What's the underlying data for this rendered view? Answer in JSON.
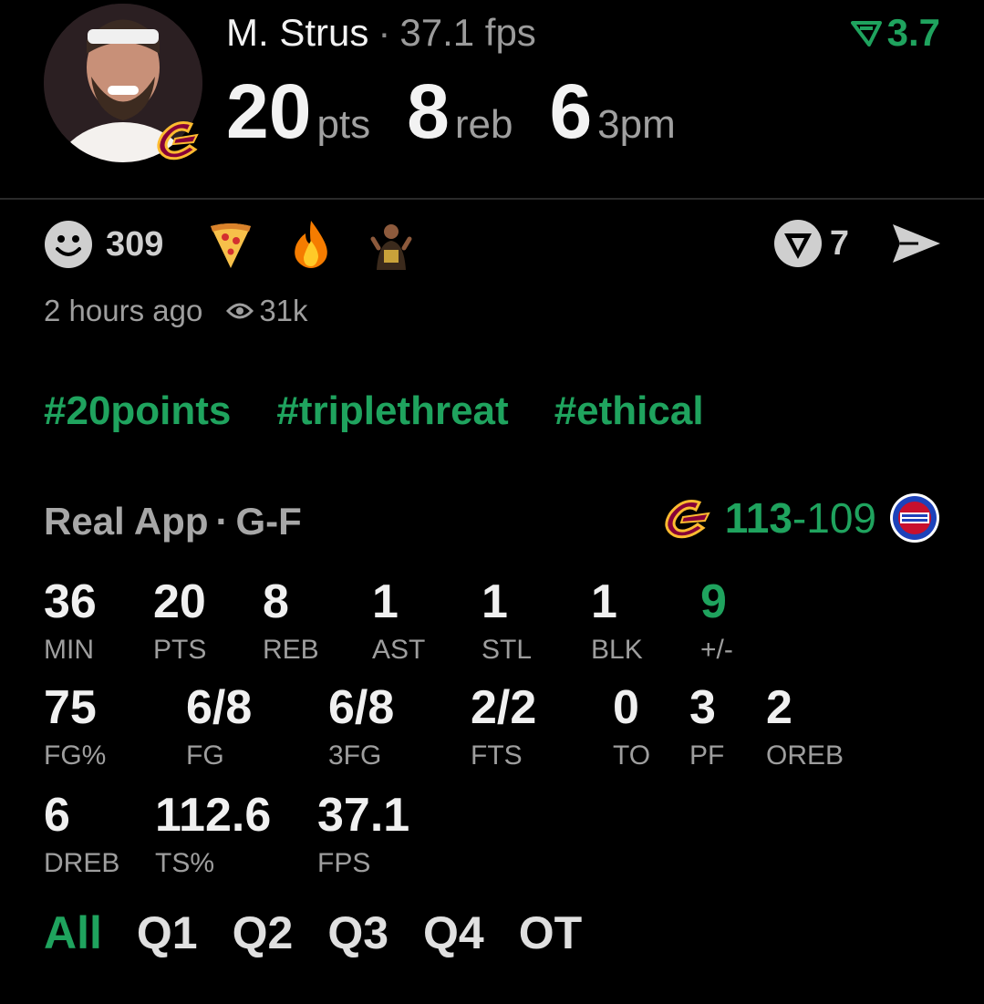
{
  "player": {
    "name": "M. Strus",
    "separator": "·",
    "fps_text": "37.1 fps",
    "rating": "3.7"
  },
  "headline": [
    {
      "value": "20",
      "unit": "pts"
    },
    {
      "value": "8",
      "unit": "reb"
    },
    {
      "value": "6",
      "unit": "3pm"
    }
  ],
  "reactions": {
    "count": "309",
    "share_count": "7"
  },
  "meta": {
    "time_ago": "2 hours ago",
    "views": "31k"
  },
  "tags": [
    "#20points",
    "#triplethreat",
    "#ethical"
  ],
  "game": {
    "source": "Real App",
    "separator": "·",
    "position": "G-F",
    "score_home": "113",
    "score_sep": "-",
    "score_away": "109"
  },
  "stats_row1": [
    {
      "value": "36",
      "label": "MIN"
    },
    {
      "value": "20",
      "label": "PTS"
    },
    {
      "value": "8",
      "label": "REB"
    },
    {
      "value": "1",
      "label": "AST"
    },
    {
      "value": "1",
      "label": "STL"
    },
    {
      "value": "1",
      "label": "BLK"
    },
    {
      "value": "9",
      "label": "+/-"
    }
  ],
  "stats_row2": [
    {
      "value": "75",
      "label": "FG%"
    },
    {
      "value": "6/8",
      "label": "FG"
    },
    {
      "value": "6/8",
      "label": "3FG"
    },
    {
      "value": "2/2",
      "label": "FTS"
    },
    {
      "value": "0",
      "label": "TO"
    },
    {
      "value": "3",
      "label": "PF"
    },
    {
      "value": "2",
      "label": "OREB"
    }
  ],
  "stats_row3": [
    {
      "value": "6",
      "label": "DREB"
    },
    {
      "value": "112.6",
      "label": "TS%"
    },
    {
      "value": "37.1",
      "label": "FPS"
    }
  ],
  "filters": [
    "All",
    "Q1",
    "Q2",
    "Q3",
    "Q4",
    "OT"
  ],
  "colors": {
    "accent": "#1fa35e",
    "cavs_wine": "#860038",
    "cavs_gold": "#FDBB30",
    "pistons_blue": "#1d42ba",
    "pistons_red": "#c8102e"
  }
}
